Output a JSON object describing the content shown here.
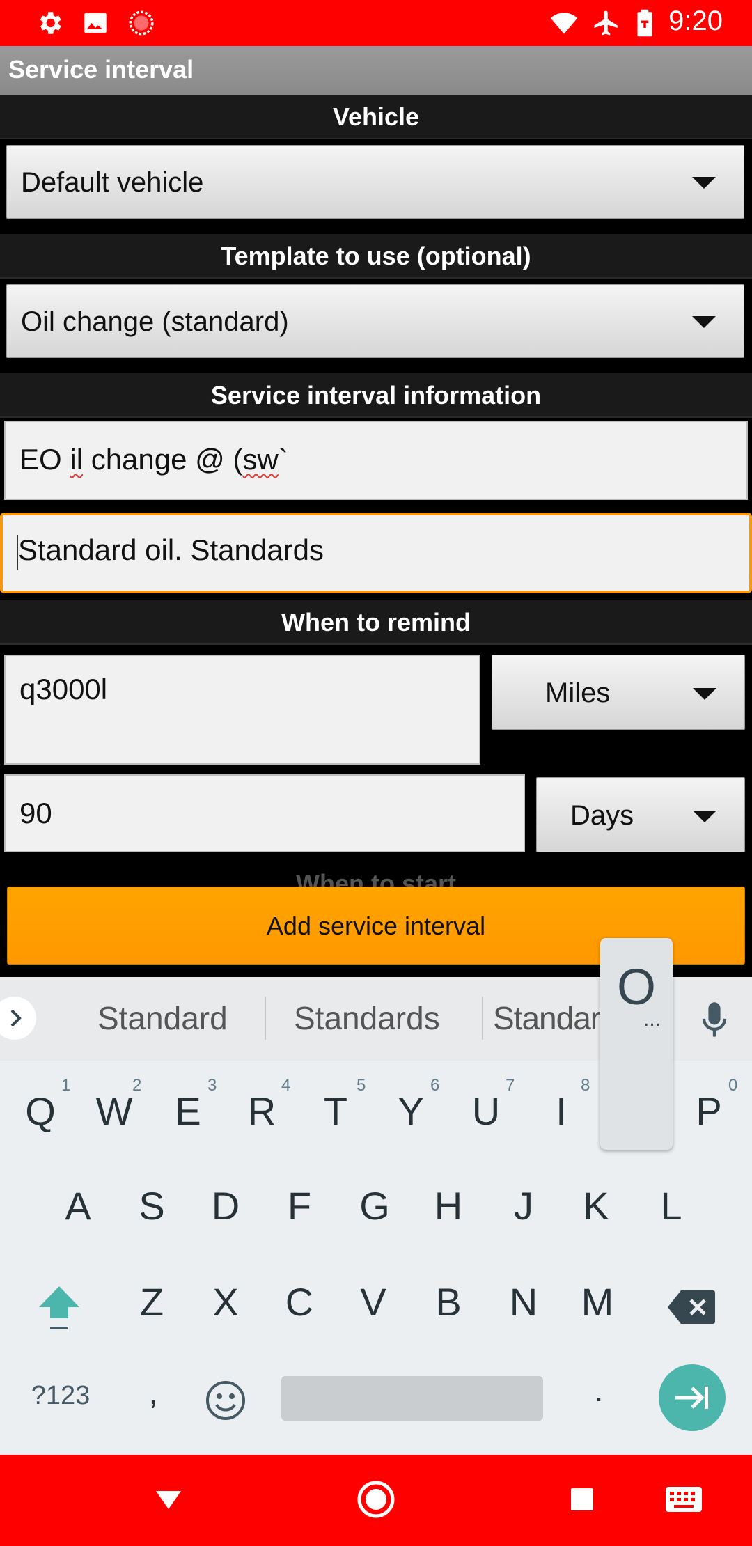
{
  "status_bar": {
    "time": "9:20"
  },
  "action_bar": {
    "title": "Service interval"
  },
  "sections": {
    "vehicle": "Vehicle",
    "template": "Template to use (optional)",
    "info": "Service interval information",
    "remind": "When to remind",
    "start": "When to start"
  },
  "vehicle_spinner": {
    "value": "Default vehicle"
  },
  "template_spinner": {
    "value": "Oil change (standard)"
  },
  "name_field": {
    "value_a": "EO ",
    "value_b": "il",
    "value_c": " change  @ (",
    "value_d": "sw",
    "value_e": "`"
  },
  "desc_field": {
    "value": "Standard oil. Standards"
  },
  "remind_distance": {
    "value": "q3000l",
    "unit": "Miles"
  },
  "remind_time": {
    "value": "90",
    "unit": "Days"
  },
  "add_button": {
    "label": "Add service interval"
  },
  "keyboard": {
    "suggestions": [
      "Standard",
      "Standards",
      "Standarc"
    ],
    "popup_key": "O",
    "popup_more": "...",
    "row1": [
      "Q",
      "W",
      "E",
      "R",
      "T",
      "Y",
      "U",
      "I",
      "P"
    ],
    "row1_hints": [
      "1",
      "2",
      "3",
      "4",
      "5",
      "6",
      "7",
      "8",
      "0"
    ],
    "row2": [
      "A",
      "S",
      "D",
      "F",
      "G",
      "H",
      "J",
      "K",
      "L"
    ],
    "row3": [
      "Z",
      "X",
      "C",
      "V",
      "B",
      "N",
      "M"
    ],
    "symbols_key": "?123",
    "comma_key": ",",
    "period_key": "."
  },
  "colors": {
    "status_bar": "#ff0000",
    "accent": "#ff9800",
    "focus": "#f39a14",
    "enter": "#4db6ac"
  }
}
